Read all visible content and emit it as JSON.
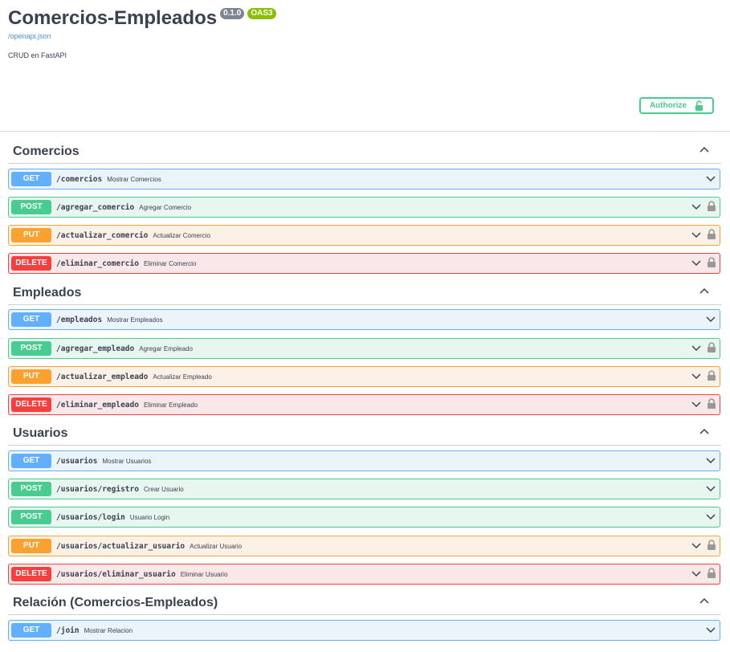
{
  "info": {
    "title": "Comercios-Empleados",
    "version": "0.1.0",
    "oas": "OAS3",
    "spec_link": "/openapi.json",
    "description": "CRUD en FastAPI"
  },
  "authorize": {
    "label": "Authorize"
  },
  "colors": {
    "get": "#61affe",
    "post": "#49cc90",
    "put": "#fca130",
    "delete": "#f93e3e"
  },
  "sections": [
    {
      "title": "Comercios",
      "ops": [
        {
          "method": "GET",
          "path": "/comercios",
          "summary": "Mostrar Comercios",
          "locked": false
        },
        {
          "method": "POST",
          "path": "/agregar_comercio",
          "summary": "Agregar Comercio",
          "locked": true
        },
        {
          "method": "PUT",
          "path": "/actualizar_comercio",
          "summary": "Actualizar Comercio",
          "locked": true
        },
        {
          "method": "DELETE",
          "path": "/eliminar_comercio",
          "summary": "Eliminar Comercio",
          "locked": true
        }
      ]
    },
    {
      "title": "Empleados",
      "ops": [
        {
          "method": "GET",
          "path": "/empleados",
          "summary": "Mostrar Empleados",
          "locked": false
        },
        {
          "method": "POST",
          "path": "/agregar_empleado",
          "summary": "Agregar Empleado",
          "locked": true
        },
        {
          "method": "PUT",
          "path": "/actualizar_empleado",
          "summary": "Actualizar Empleado",
          "locked": true
        },
        {
          "method": "DELETE",
          "path": "/eliminar_empleado",
          "summary": "Eliminar Empleado",
          "locked": true
        }
      ]
    },
    {
      "title": "Usuarios",
      "ops": [
        {
          "method": "GET",
          "path": "/usuarios",
          "summary": "Mostrar Usuarios",
          "locked": false
        },
        {
          "method": "POST",
          "path": "/usuarios/registro",
          "summary": "Crear Usuario",
          "locked": false
        },
        {
          "method": "POST",
          "path": "/usuarios/login",
          "summary": "Usuario Login",
          "locked": false
        },
        {
          "method": "PUT",
          "path": "/usuarios/actualizar_usuario",
          "summary": "Actualizar Usuario",
          "locked": true
        },
        {
          "method": "DELETE",
          "path": "/usuarios/eliminar_usuario",
          "summary": "Eliminar Usuario",
          "locked": true
        }
      ]
    },
    {
      "title": "Relación (Comercios-Empleados)",
      "ops": [
        {
          "method": "GET",
          "path": "/join",
          "summary": "Mostrar Relacion",
          "locked": false
        }
      ]
    }
  ]
}
